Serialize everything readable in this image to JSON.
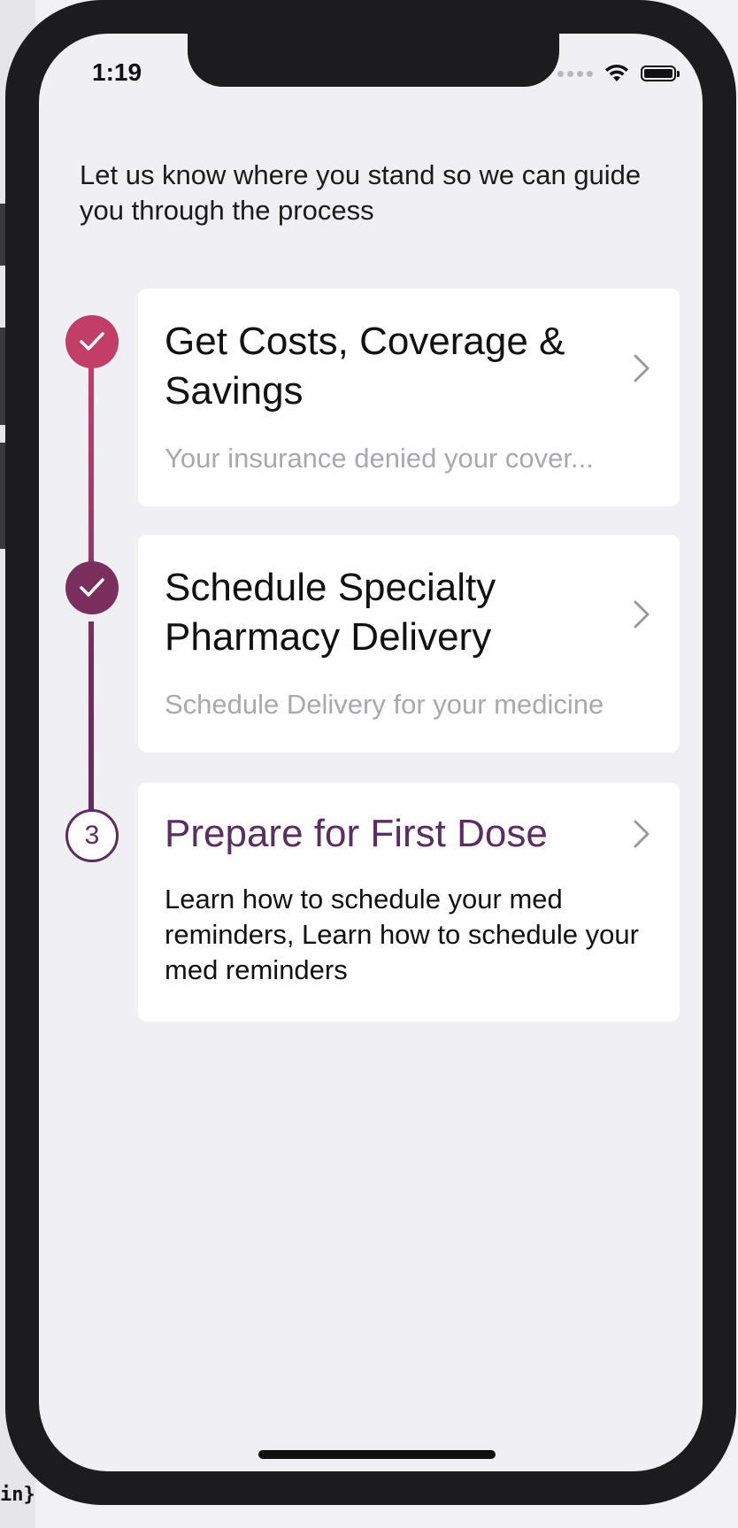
{
  "status_bar": {
    "time": "1:19"
  },
  "intro_text": "Let us know where you stand so we can guide you through the process",
  "steps": [
    {
      "status": "completed",
      "title": "Get Costs, Coverage & Savings",
      "subtitle": "Your insurance denied your cover...",
      "color": "#c23d68"
    },
    {
      "status": "completed",
      "title": "Schedule Specialty Pharmacy Delivery",
      "subtitle": "Schedule Delivery for your medicine",
      "color": "#7a2f5c"
    },
    {
      "status": "current",
      "number": "3",
      "title": "Prepare for First Dose",
      "description": "Learn how to schedule your med reminders, Learn how to schedule your med reminders",
      "color": "#5a2d63"
    }
  ],
  "background_code_fragment": "in}"
}
